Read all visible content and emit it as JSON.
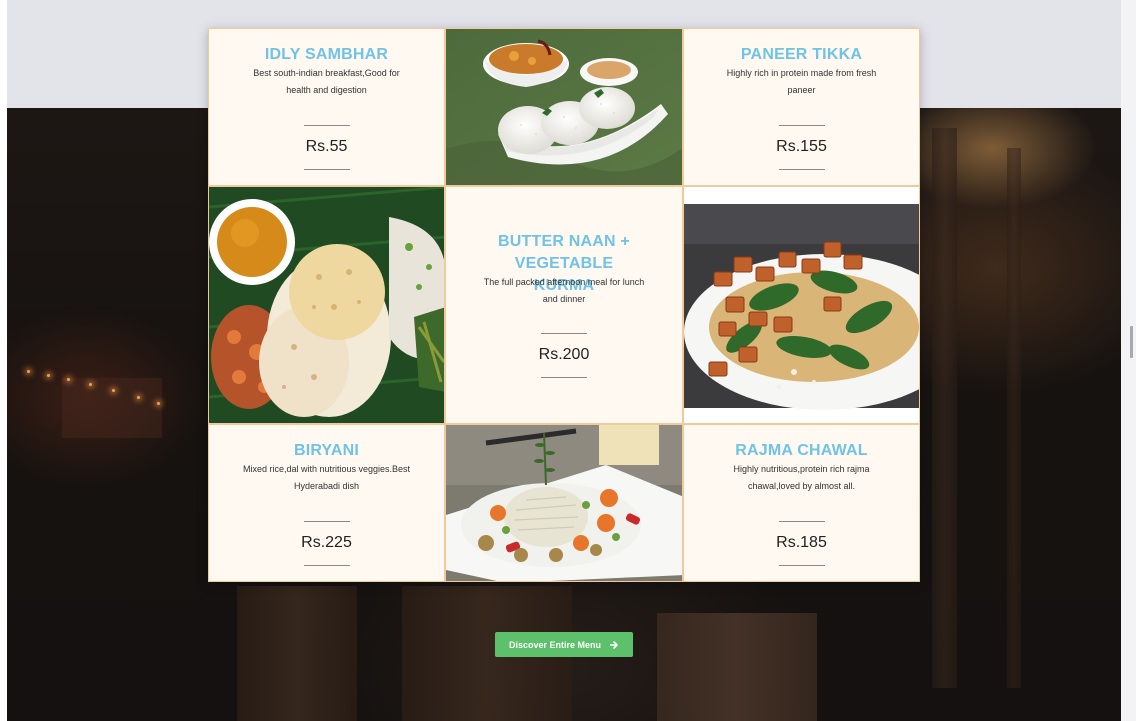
{
  "menu": {
    "items": [
      {
        "name": "IDLY SAMBHAR",
        "description": "Best south-indian breakfast,Good for health and digestion",
        "price": "Rs.55"
      },
      {
        "name": "PANEER TIKKA",
        "description": "Highly rich in protein made from fresh paneer",
        "price": "Rs.155"
      },
      {
        "name": "BUTTER NAAN + VEGETABLE KURMA",
        "description": "The full packed afternoon meal for lunch and dinner",
        "price": "Rs.200"
      },
      {
        "name": "BIRYANI",
        "description": "Mixed rice,dal with nutritious veggies.Best Hyderabadi dish",
        "price": "Rs.225"
      },
      {
        "name": "RAJMA CHAWAL",
        "description": "Highly nutritious,protein rich rajma chawal,loved by almost all.",
        "price": "Rs.185"
      }
    ]
  },
  "cta": {
    "label": "Discover Entire Menu",
    "icon": "arrow-right-icon"
  },
  "photos": [
    "idli-sambar-photo",
    "naan-papad-curry-photo",
    "paneer-salad-photo",
    "rice-vegetables-photo"
  ],
  "colors": {
    "title": "#6ec3e6",
    "card_bg": "#fff9f1",
    "card_border": "#f2c99a",
    "button": "#5cc16a",
    "top_band": "#e3e3ea"
  }
}
